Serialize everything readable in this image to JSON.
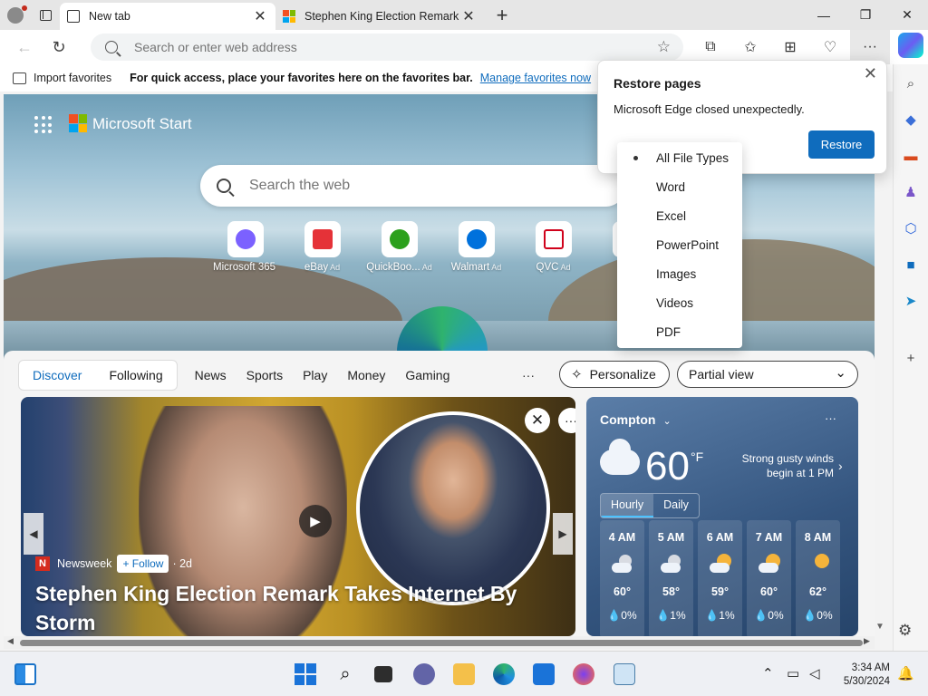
{
  "browser": {
    "tabs": [
      {
        "title": "New tab",
        "active": true
      },
      {
        "title": "Stephen King Election Remark Takes Internet By Storm",
        "active": false
      }
    ],
    "address_placeholder": "Search or enter web address",
    "icons": [
      "profile-icon",
      "tab-actions-icon",
      "new-tab-icon",
      "back-icon",
      "refresh-icon",
      "favorite-star-icon",
      "extensions-icon",
      "favorites-icon",
      "collections-icon",
      "browser-essentials-icon",
      "more-icon",
      "copilot-icon"
    ]
  },
  "favbar": {
    "import_label": "Import favorites",
    "message": "For quick access, place your favorites here on the favorites bar.",
    "manage_link": "Manage favorites now"
  },
  "restore_popup": {
    "title": "Restore pages",
    "body": "Microsoft Edge closed unexpectedly.",
    "button": "Restore"
  },
  "file_types_menu": {
    "selected": "All File Types",
    "options": [
      "All File Types",
      "Word",
      "Excel",
      "PowerPoint",
      "Images",
      "Videos",
      "PDF"
    ]
  },
  "ntp": {
    "brand": "Microsoft Start",
    "search_placeholder": "Search the web",
    "quicklinks": [
      {
        "label": "Microsoft 365",
        "ad": "",
        "color": "#7b61ff"
      },
      {
        "label": "eBay",
        "ad": "Ad",
        "color": "#e53238"
      },
      {
        "label": "QuickBoo...",
        "ad": "Ad",
        "color": "#2ca01c"
      },
      {
        "label": "Walmart",
        "ad": "Ad",
        "color": "#0071dc"
      },
      {
        "label": "QVC",
        "ad": "Ad",
        "color": "#d0021b"
      },
      {
        "label": "Ad",
        "ad": "",
        "color": "#cccccc"
      }
    ]
  },
  "feed": {
    "segment": [
      "Discover",
      "Following"
    ],
    "nav": [
      "News",
      "Sports",
      "Play",
      "Money",
      "Gaming"
    ],
    "more": "···",
    "personalize": "Personalize",
    "view_select": "Partial view"
  },
  "story": {
    "source": "Newsweek",
    "follow": "+ Follow",
    "age": "· 2d",
    "headline": "Stephen King Election Remark Takes Internet By Storm"
  },
  "weather": {
    "location": "Compton",
    "temp": "60",
    "unit": "°F",
    "condition": "Strong gusty winds begin at 1 PM",
    "tabs": [
      "Hourly",
      "Daily"
    ],
    "hours": [
      {
        "time": "4 AM",
        "temp": "60°",
        "precip": "0%",
        "icon": "night-cloud"
      },
      {
        "time": "5 AM",
        "temp": "58°",
        "precip": "1%",
        "icon": "night-cloud"
      },
      {
        "time": "6 AM",
        "temp": "59°",
        "precip": "1%",
        "icon": "sun-cloud"
      },
      {
        "time": "7 AM",
        "temp": "60°",
        "precip": "0%",
        "icon": "sun-cloud"
      },
      {
        "time": "8 AM",
        "temp": "62°",
        "precip": "0%",
        "icon": "sun-cloud"
      }
    ]
  },
  "taskbar": {
    "time": "3:34 AM",
    "date": "5/30/2024"
  },
  "colors": {
    "accent": "#0f6cbd",
    "tabbar": "#e6e6e6",
    "restore_button": "#0f6cbd",
    "weather_bg": "#34557f"
  }
}
